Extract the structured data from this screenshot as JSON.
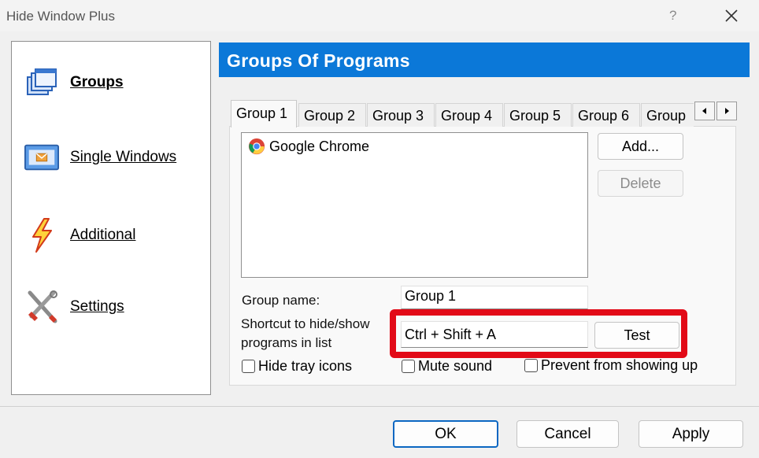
{
  "window": {
    "title": "Hide Window Plus",
    "help_label": "?"
  },
  "sidebar": {
    "items": [
      {
        "label": "Groups",
        "icon": "windows-stack-icon"
      },
      {
        "label": "Single Windows",
        "icon": "single-window-icon"
      },
      {
        "label": "Additional",
        "icon": "lightning-icon"
      },
      {
        "label": "Settings",
        "icon": "tools-icon"
      }
    ]
  },
  "header": {
    "title": "Groups Of Programs"
  },
  "tabs": [
    "Group 1",
    "Group 2",
    "Group 3",
    "Group 4",
    "Group 5",
    "Group 6",
    "Group"
  ],
  "programs": [
    {
      "name": "Google Chrome",
      "icon": "chrome-icon"
    }
  ],
  "buttons": {
    "add": "Add...",
    "delete": "Delete",
    "test": "Test"
  },
  "form": {
    "group_name_label": "Group name:",
    "group_name_value": "Group 1",
    "shortcut_label_line1": "Shortcut to hide/show",
    "shortcut_label_line2": "programs in list",
    "shortcut_value": "Ctrl + Shift + A"
  },
  "options": {
    "hide_tray_icons": "Hide tray icons",
    "mute_sound": "Mute sound",
    "prevent_showing": "Prevent from showing up"
  },
  "footer": {
    "ok": "OK",
    "cancel": "Cancel",
    "apply": "Apply"
  },
  "colors": {
    "header_bg": "#0b78d8",
    "highlight": "#e20a17"
  }
}
